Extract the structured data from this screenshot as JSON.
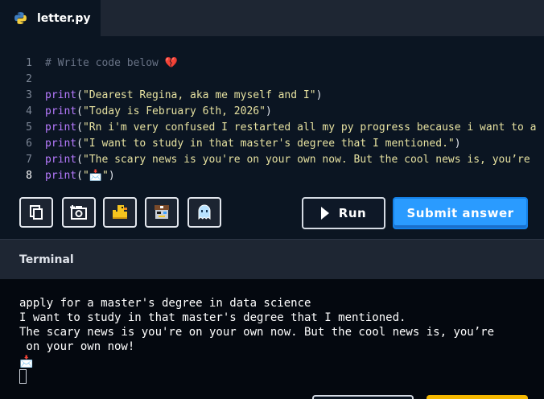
{
  "tab": {
    "filename": "letter.py",
    "icon": "python-icon"
  },
  "editor": {
    "active_line": 8,
    "lines": [
      {
        "num": "1",
        "parts": [
          {
            "cls": "cmt",
            "text": "# Write code below "
          },
          {
            "cls": "emoji",
            "text": "💔"
          }
        ]
      },
      {
        "num": "2",
        "parts": []
      },
      {
        "num": "3",
        "parts": [
          {
            "cls": "kw",
            "text": "print"
          },
          {
            "cls": "pun",
            "text": "("
          },
          {
            "cls": "str",
            "text": "\"Dearest Regina, aka me myself and I\""
          },
          {
            "cls": "pun",
            "text": ")"
          }
        ]
      },
      {
        "num": "4",
        "parts": [
          {
            "cls": "kw",
            "text": "print"
          },
          {
            "cls": "pun",
            "text": "("
          },
          {
            "cls": "str",
            "text": "\"Today is February 6th, 2026\""
          },
          {
            "cls": "pun",
            "text": ")"
          }
        ]
      },
      {
        "num": "5",
        "parts": [
          {
            "cls": "kw",
            "text": "print"
          },
          {
            "cls": "pun",
            "text": "("
          },
          {
            "cls": "str",
            "text": "\"Rn i'm very confused I restarted all my py progress because i want to a"
          }
        ]
      },
      {
        "num": "6",
        "parts": [
          {
            "cls": "kw",
            "text": "print"
          },
          {
            "cls": "pun",
            "text": "("
          },
          {
            "cls": "str",
            "text": "\"I want to study in that master's degree that I mentioned.\""
          },
          {
            "cls": "pun",
            "text": ")"
          }
        ]
      },
      {
        "num": "7",
        "parts": [
          {
            "cls": "kw",
            "text": "print"
          },
          {
            "cls": "pun",
            "text": "("
          },
          {
            "cls": "str",
            "text": "\"The scary news is you're on your own now. But the cool news is, you’re"
          }
        ]
      },
      {
        "num": "8",
        "parts": [
          {
            "cls": "kw",
            "text": "print"
          },
          {
            "cls": "pun",
            "text": "("
          },
          {
            "cls": "str",
            "text": "\"📩\""
          },
          {
            "cls": "pun",
            "text": ")"
          }
        ]
      }
    ]
  },
  "toolbar": {
    "tools": [
      {
        "name": "copy-button",
        "icon": "copy-icon"
      },
      {
        "name": "screenshot-button",
        "icon": "camera-icon"
      },
      {
        "name": "duck-button",
        "icon": "rubber-duck-icon"
      },
      {
        "name": "pirate-bot-button",
        "icon": "pirate-bot-icon"
      },
      {
        "name": "ghost-button",
        "icon": "ghost-icon"
      }
    ],
    "run_label": "Run",
    "submit_label": "Submit answer"
  },
  "terminal": {
    "title": "Terminal",
    "lines": [
      "apply for a master's degree in data science",
      "I want to study in that master's degree that I mentioned.",
      "The scary news is you're on your own now. But the cool news is, you’re",
      " on your own now!",
      "📩"
    ]
  },
  "colors": {
    "accent": "#2a9bff",
    "background": "#0b1522",
    "terminal_bg": "#04080f"
  }
}
